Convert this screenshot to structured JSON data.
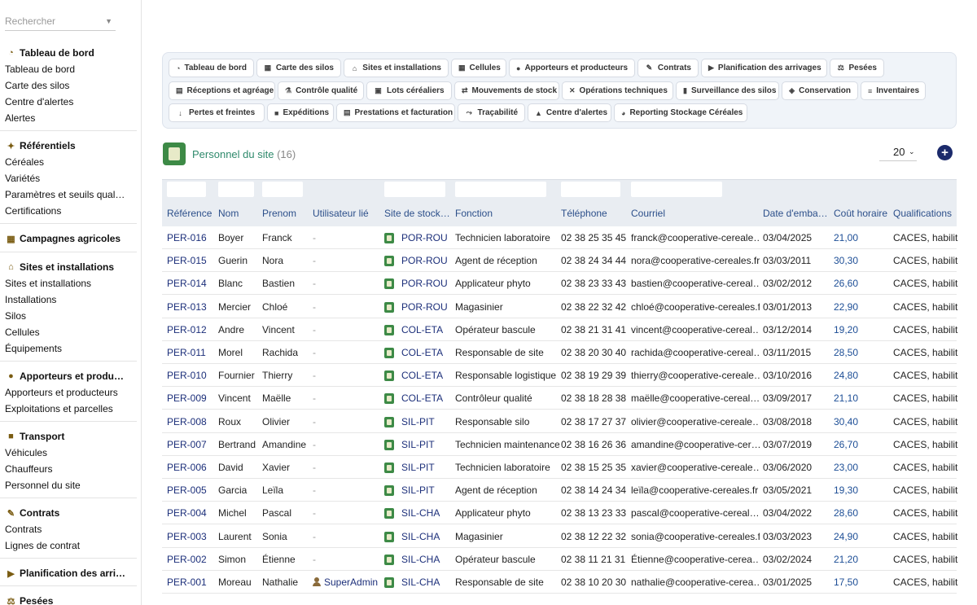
{
  "sidebar": {
    "search_placeholder": "Rechercher",
    "sections": [
      {
        "title": "Tableau de bord",
        "icon": "gauge-icon",
        "items": [
          "Tableau de bord",
          "Carte des silos",
          "Centre d'alertes",
          "Alertes"
        ]
      },
      {
        "title": "Référentiels",
        "icon": "sprout-icon",
        "items": [
          "Céréales",
          "Variétés",
          "Paramètres et seuils qual…",
          "Certifications"
        ]
      },
      {
        "title": "Campagnes agricoles",
        "icon": "calendar-icon",
        "items": []
      },
      {
        "title": "Sites et installations",
        "icon": "warehouse-icon",
        "items": [
          "Sites et installations",
          "Installations",
          "Silos",
          "Cellules",
          "Équipements"
        ]
      },
      {
        "title": "Apporteurs et produ…",
        "icon": "users-icon",
        "items": [
          "Apporteurs et producteurs",
          "Exploitations et parcelles"
        ]
      },
      {
        "title": "Transport",
        "icon": "truck-icon",
        "items": [
          "Véhicules",
          "Chauffeurs",
          "Personnel du site"
        ]
      },
      {
        "title": "Contrats",
        "icon": "contract-icon",
        "items": [
          "Contrats",
          "Lignes de contrat"
        ]
      },
      {
        "title": "Planification des arri…",
        "icon": "truck-ramp-icon",
        "items": []
      },
      {
        "title": "Pesées",
        "icon": "scale-icon",
        "items": []
      }
    ]
  },
  "toolbar": {
    "rows": [
      [
        {
          "label": "Tableau de bord",
          "icon": "gauge-icon"
        },
        {
          "label": "Carte des silos",
          "icon": "grid-icon"
        },
        {
          "label": "Sites et installations",
          "icon": "warehouse-icon"
        },
        {
          "label": "Cellules",
          "icon": "grid-icon"
        },
        {
          "label": "Apporteurs et producteurs",
          "icon": "users-icon"
        },
        {
          "label": "Contrats",
          "icon": "contract-icon"
        },
        {
          "label": "Planification des arrivages",
          "icon": "truck-ramp-icon"
        },
        {
          "label": "Pesées",
          "icon": "scale-icon"
        }
      ],
      [
        {
          "label": "Réceptions et agréage",
          "icon": "clipboard-icon"
        },
        {
          "label": "Contrôle qualité",
          "icon": "flask-icon"
        },
        {
          "label": "Lots céréaliers",
          "icon": "box-icon"
        },
        {
          "label": "Mouvements de stock",
          "icon": "arrows-icon"
        },
        {
          "label": "Opérations techniques",
          "icon": "tools-icon"
        },
        {
          "label": "Surveillance des silos",
          "icon": "thermometer-icon"
        },
        {
          "label": "Conservation",
          "icon": "shield-icon"
        },
        {
          "label": "Inventaires",
          "icon": "list-icon"
        }
      ],
      [
        {
          "label": "Pertes et freintes",
          "icon": "arrow-down-icon"
        },
        {
          "label": "Expéditions",
          "icon": "truck-icon"
        },
        {
          "label": "Prestations et facturation",
          "icon": "invoice-icon"
        },
        {
          "label": "Traçabilité",
          "icon": "flow-icon"
        },
        {
          "label": "Centre d'alertes",
          "icon": "bell-icon"
        },
        {
          "label": "Reporting Stockage Céréales",
          "icon": "chart-pie-icon"
        }
      ]
    ]
  },
  "page": {
    "title": "Personnel du site",
    "count": "(16)",
    "page_size": "20",
    "add_label": "+"
  },
  "table": {
    "columns": [
      "Référence",
      "Nom",
      "Prenom",
      "Utilisateur lié",
      "Site de stock…",
      "Fonction",
      "Téléphone",
      "Courriel",
      "Date d'emba…",
      "Coût horaire",
      "Qualifications"
    ],
    "rows": [
      [
        "PER-016",
        "Boyer",
        "Franck",
        "-",
        "POR-ROU",
        "Technicien laboratoire",
        "02 38 25 35 45",
        "franck@cooperative-cereale…",
        "03/04/2025",
        "21,00",
        "CACES, habilita"
      ],
      [
        "PER-015",
        "Guerin",
        "Nora",
        "-",
        "POR-ROU",
        "Agent de réception",
        "02 38 24 34 44",
        "nora@cooperative-cereales.fr",
        "03/03/2011",
        "30,30",
        "CACES, habilita"
      ],
      [
        "PER-014",
        "Blanc",
        "Bastien",
        "-",
        "POR-ROU",
        "Applicateur phyto",
        "02 38 23 33 43",
        "bastien@cooperative-cereal…",
        "03/02/2012",
        "26,60",
        "CACES, habilita"
      ],
      [
        "PER-013",
        "Mercier",
        "Chloé",
        "-",
        "POR-ROU",
        "Magasinier",
        "02 38 22 32 42",
        "chloé@cooperative-cereales.fr",
        "03/01/2013",
        "22,90",
        "CACES, habilita"
      ],
      [
        "PER-012",
        "Andre",
        "Vincent",
        "-",
        "COL-ETA",
        "Opérateur bascule",
        "02 38 21 31 41",
        "vincent@cooperative-cereal…",
        "03/12/2014",
        "19,20",
        "CACES, habilita"
      ],
      [
        "PER-011",
        "Morel",
        "Rachida",
        "-",
        "COL-ETA",
        "Responsable de site",
        "02 38 20 30 40",
        "rachida@cooperative-cereal…",
        "03/11/2015",
        "28,50",
        "CACES, habilita"
      ],
      [
        "PER-010",
        "Fournier",
        "Thierry",
        "-",
        "COL-ETA",
        "Responsable logistique",
        "02 38 19 29 39",
        "thierry@cooperative-cereale…",
        "03/10/2016",
        "24,80",
        "CACES, habilita"
      ],
      [
        "PER-009",
        "Vincent",
        "Maëlle",
        "-",
        "COL-ETA",
        "Contrôleur qualité",
        "02 38 18 28 38",
        "maëlle@cooperative-cereal…",
        "03/09/2017",
        "21,10",
        "CACES, habilita"
      ],
      [
        "PER-008",
        "Roux",
        "Olivier",
        "-",
        "SIL-PIT",
        "Responsable silo",
        "02 38 17 27 37",
        "olivier@cooperative-cereale…",
        "03/08/2018",
        "30,40",
        "CACES, habilita"
      ],
      [
        "PER-007",
        "Bertrand",
        "Amandine",
        "-",
        "SIL-PIT",
        "Technicien maintenance",
        "02 38 16 26 36",
        "amandine@cooperative-cer…",
        "03/07/2019",
        "26,70",
        "CACES, habilita"
      ],
      [
        "PER-006",
        "David",
        "Xavier",
        "-",
        "SIL-PIT",
        "Technicien laboratoire",
        "02 38 15 25 35",
        "xavier@cooperative-cereale…",
        "03/06/2020",
        "23,00",
        "CACES, habilita"
      ],
      [
        "PER-005",
        "Garcia",
        "Leïla",
        "-",
        "SIL-PIT",
        "Agent de réception",
        "02 38 14 24 34",
        "leïla@cooperative-cereales.fr",
        "03/05/2021",
        "19,30",
        "CACES, habilita"
      ],
      [
        "PER-004",
        "Michel",
        "Pascal",
        "-",
        "SIL-CHA",
        "Applicateur phyto",
        "02 38 13 23 33",
        "pascal@cooperative-cereal…",
        "03/04/2022",
        "28,60",
        "CACES, habilita"
      ],
      [
        "PER-003",
        "Laurent",
        "Sonia",
        "-",
        "SIL-CHA",
        "Magasinier",
        "02 38 12 22 32",
        "sonia@cooperative-cereales.fr",
        "03/03/2023",
        "24,90",
        "CACES, habilita"
      ],
      [
        "PER-002",
        "Simon",
        "Étienne",
        "-",
        "SIL-CHA",
        "Opérateur bascule",
        "02 38 11 21 31",
        "Étienne@cooperative-cerea…",
        "03/02/2024",
        "21,20",
        "CACES, habilita"
      ],
      [
        "PER-001",
        "Moreau",
        "Nathalie",
        "SuperAdmin",
        "SIL-CHA",
        "Responsable de site",
        "02 38 10 20 30",
        "nathalie@cooperative-cerea…",
        "03/01/2025",
        "17,50",
        "CACES, habilita"
      ]
    ]
  }
}
